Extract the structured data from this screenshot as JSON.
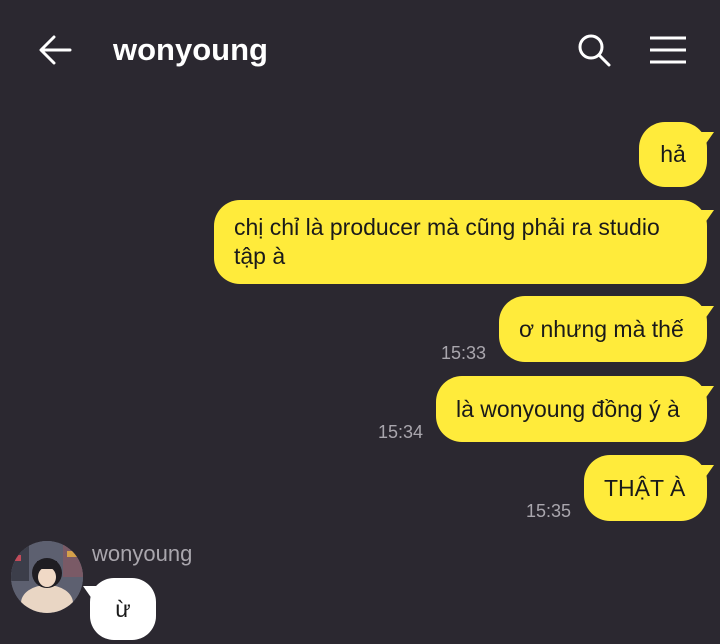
{
  "header": {
    "title": "wonyoung",
    "back_icon": "arrow-left-icon",
    "search_icon": "search-icon",
    "menu_icon": "hamburger-menu-icon"
  },
  "messages_out": [
    {
      "text": "hả",
      "time": ""
    },
    {
      "text": "chị chỉ là producer mà cũng phải ra studio\ntập à",
      "time": ""
    },
    {
      "text": "ơ nhưng mà thế",
      "time": "15:33"
    },
    {
      "text": "là wonyoung đồng ý à",
      "time": "15:34"
    },
    {
      "text": "THẬT À",
      "time": "15:35"
    }
  ],
  "message_in": {
    "sender": "wonyoung",
    "text": "ừ"
  },
  "colors": {
    "background": "#2b2830",
    "outgoing_bubble": "#ffeb3b",
    "incoming_bubble": "#ffffff",
    "timestamp": "#a9a6ad"
  }
}
